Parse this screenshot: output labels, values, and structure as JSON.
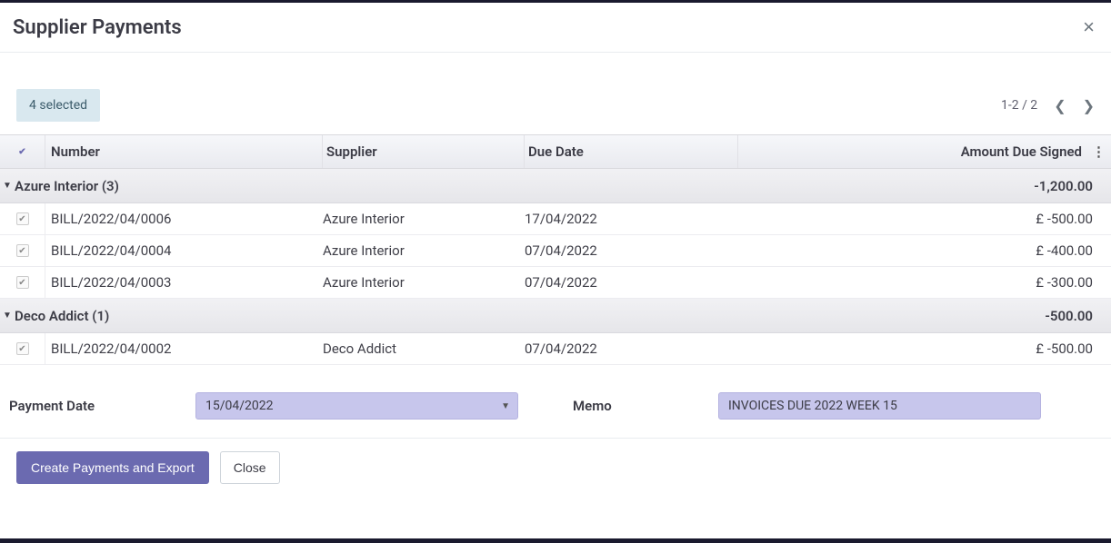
{
  "modal": {
    "title": "Supplier Payments",
    "selected_badge": "4 selected",
    "pager_text": "1-2 / 2"
  },
  "columns": {
    "number": "Number",
    "supplier": "Supplier",
    "due": "Due Date",
    "amount": "Amount Due Signed"
  },
  "groups": [
    {
      "label": "Azure Interior (3)",
      "total": "-1,200.00",
      "rows": [
        {
          "number": "BILL/2022/04/0006",
          "supplier": "Azure Interior",
          "due": "17/04/2022",
          "amount": "£ -500.00"
        },
        {
          "number": "BILL/2022/04/0004",
          "supplier": "Azure Interior",
          "due": "07/04/2022",
          "amount": "£ -400.00"
        },
        {
          "number": "BILL/2022/04/0003",
          "supplier": "Azure Interior",
          "due": "07/04/2022",
          "amount": "£ -300.00"
        }
      ]
    },
    {
      "label": "Deco Addict (1)",
      "total": "-500.00",
      "rows": [
        {
          "number": "BILL/2022/04/0002",
          "supplier": "Deco Addict",
          "due": "07/04/2022",
          "amount": "£ -500.00"
        }
      ]
    }
  ],
  "form": {
    "payment_date_label": "Payment Date",
    "payment_date_value": "15/04/2022",
    "memo_label": "Memo",
    "memo_value": "INVOICES DUE 2022 WEEK 15"
  },
  "footer": {
    "primary": "Create Payments and Export",
    "secondary": "Close"
  }
}
